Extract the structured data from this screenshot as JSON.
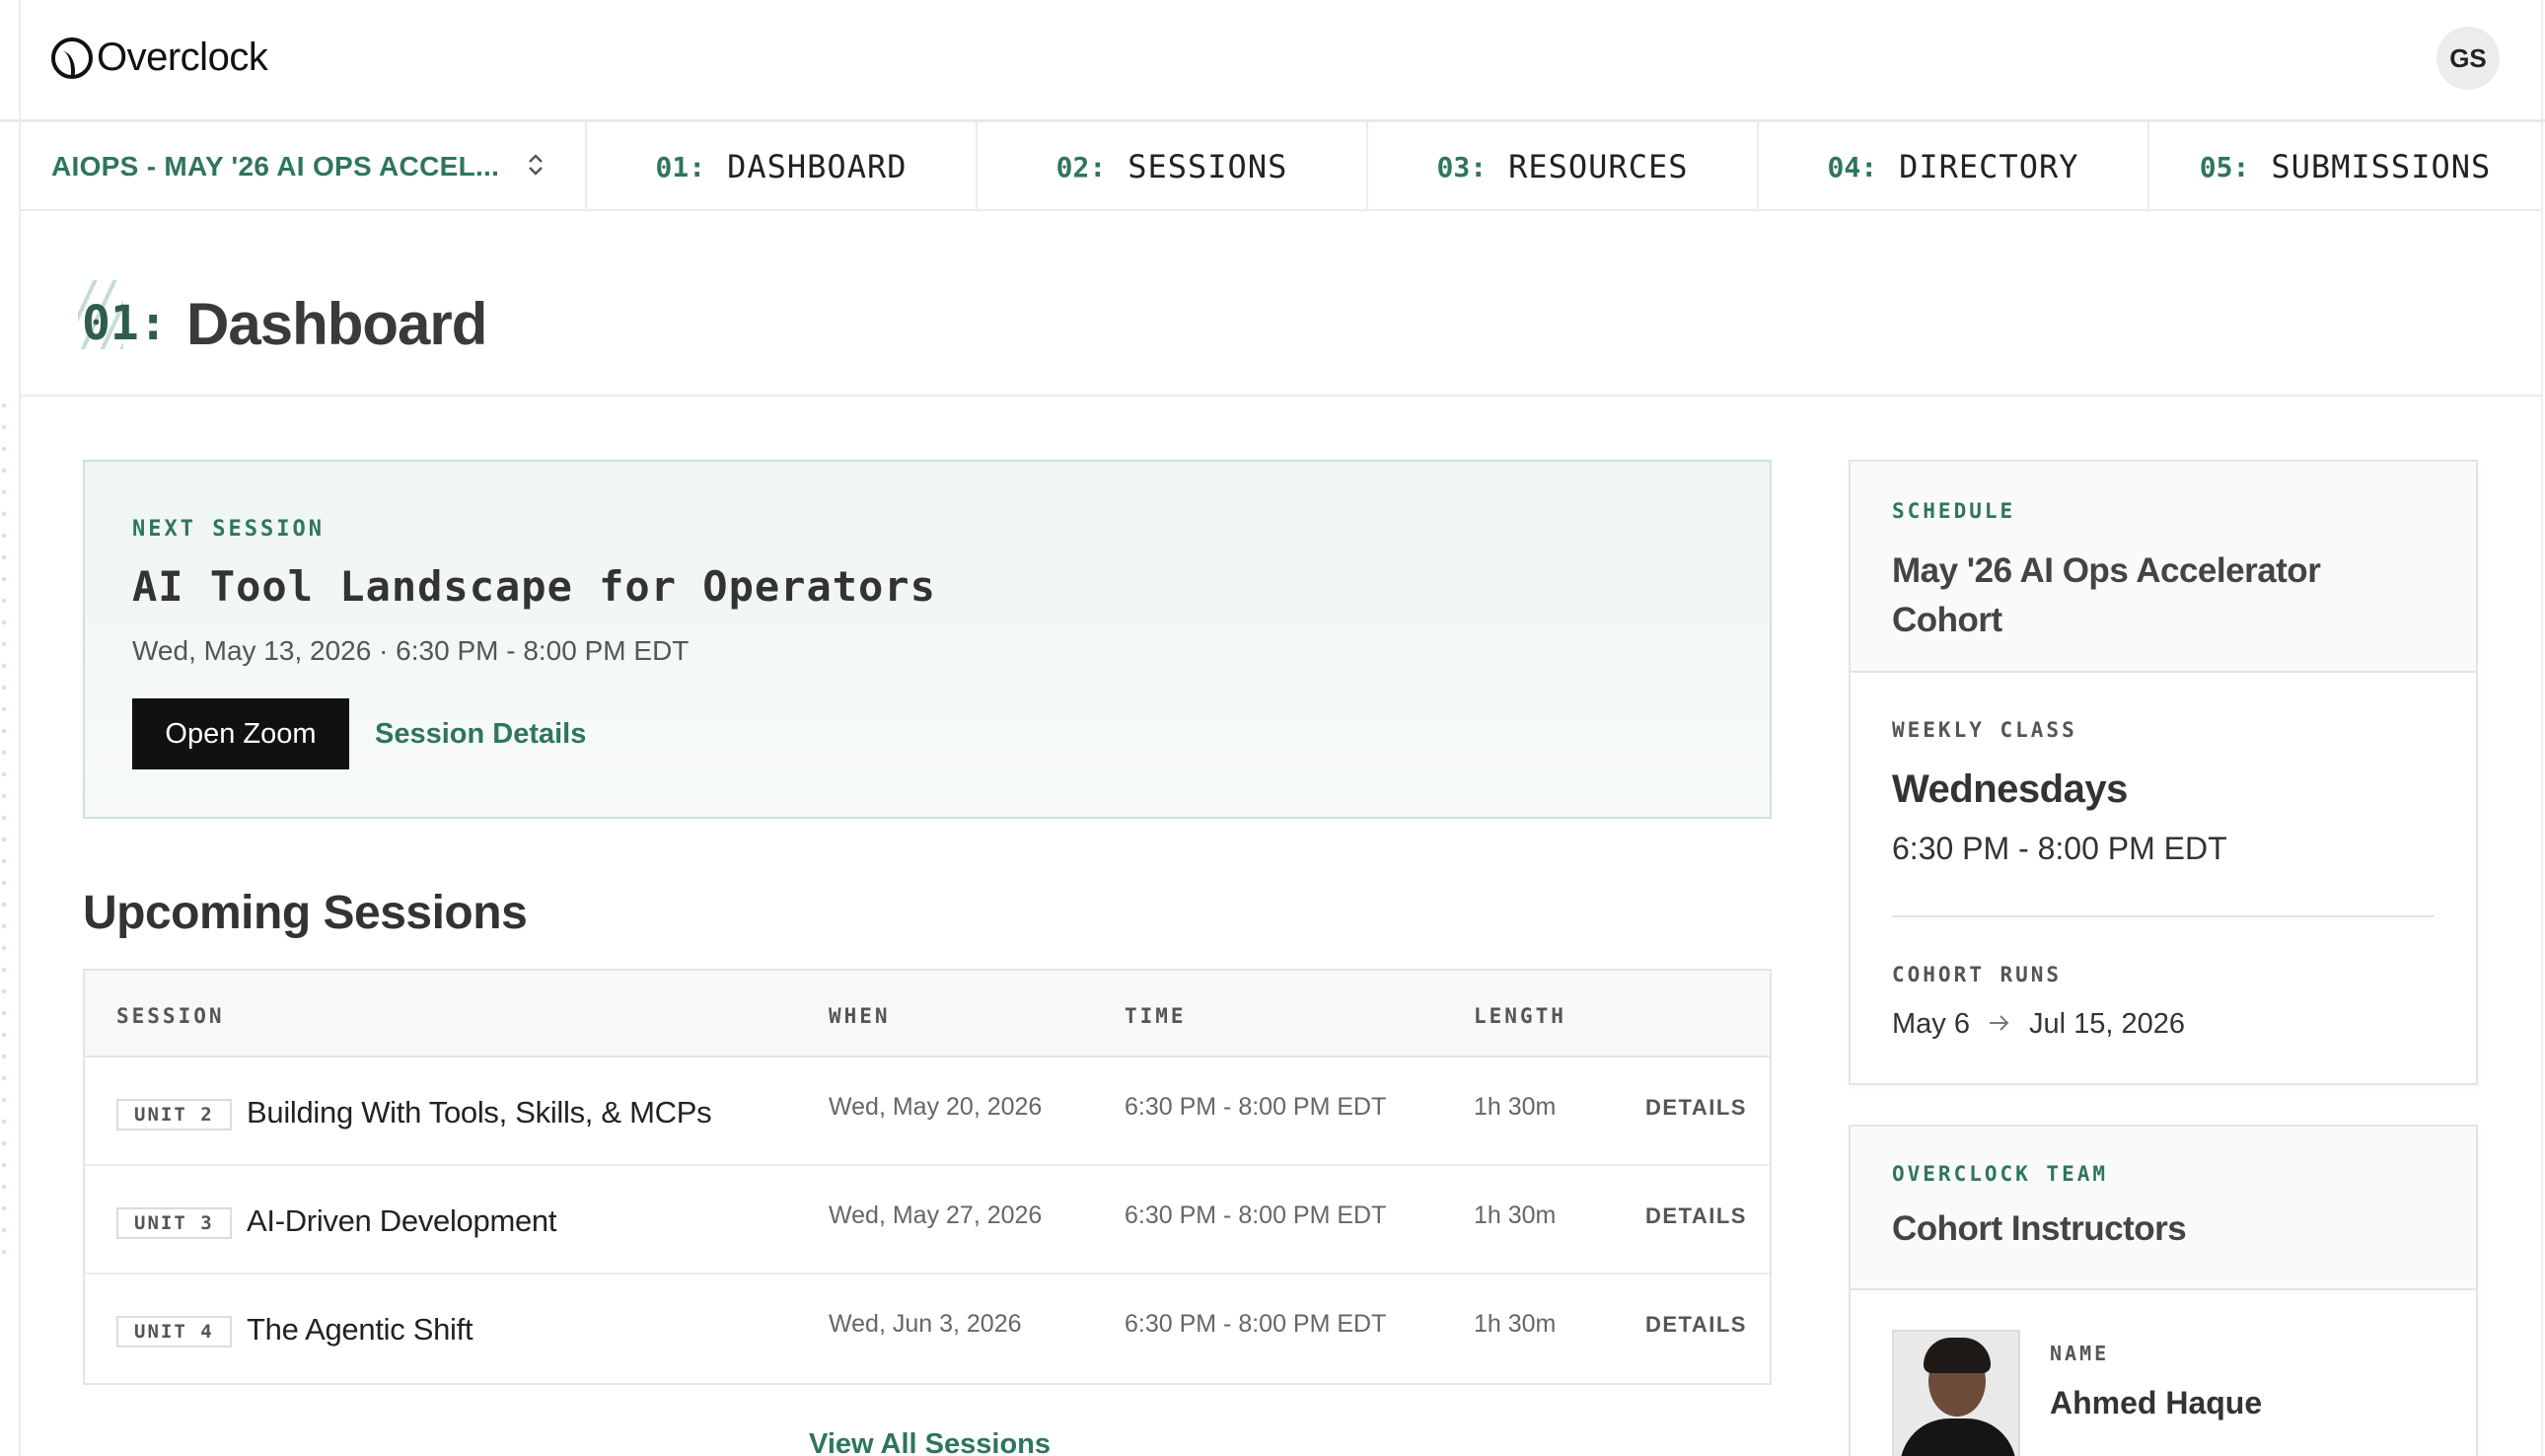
{
  "brand": {
    "name": "Overclock",
    "user_initials": "GS"
  },
  "nav": {
    "program": "AIOPS - MAY '26 AI OPS ACCEL...",
    "tabs": [
      {
        "num": "01:",
        "label": "DASHBOARD"
      },
      {
        "num": "02:",
        "label": "SESSIONS"
      },
      {
        "num": "03:",
        "label": "RESOURCES"
      },
      {
        "num": "04:",
        "label": "DIRECTORY"
      },
      {
        "num": "05:",
        "label": "SUBMISSIONS"
      }
    ]
  },
  "page": {
    "num": "01:",
    "title": "Dashboard"
  },
  "next_session": {
    "eyebrow": "NEXT SESSION",
    "title": "AI Tool Landscape for Operators",
    "when": "Wed, May 13, 2026 · 6:30 PM - 8:00 PM EDT",
    "zoom_label": "Open Zoom",
    "details_label": "Session Details"
  },
  "upcoming": {
    "heading": "Upcoming Sessions",
    "columns": {
      "session": "SESSION",
      "when": "WHEN",
      "time": "TIME",
      "length": "LENGTH"
    },
    "rows": [
      {
        "unit": "UNIT 2",
        "title": "Building With Tools, Skills, & MCPs",
        "when": "Wed, May 20, 2026",
        "time": "6:30 PM - 8:00 PM EDT",
        "length": "1h 30m",
        "details": "DETAILS"
      },
      {
        "unit": "UNIT 3",
        "title": "AI-Driven Development",
        "when": "Wed, May 27, 2026",
        "time": "6:30 PM - 8:00 PM EDT",
        "length": "1h 30m",
        "details": "DETAILS"
      },
      {
        "unit": "UNIT 4",
        "title": "The Agentic Shift",
        "when": "Wed, Jun 3, 2026",
        "time": "6:30 PM - 8:00 PM EDT",
        "length": "1h 30m",
        "details": "DETAILS"
      }
    ],
    "view_all": "View All Sessions"
  },
  "schedule": {
    "eyebrow": "SCHEDULE",
    "title": "May '26 AI Ops Accelerator Cohort",
    "weekly_label": "WEEKLY CLASS",
    "weekly_day": "Wednesdays",
    "weekly_time": "6:30 PM - 8:00 PM EDT",
    "runs_label": "COHORT RUNS",
    "runs_start": "May 6",
    "runs_end": "Jul 15, 2026"
  },
  "team": {
    "eyebrow": "OVERCLOCK TEAM",
    "title": "Cohort Instructors",
    "name_label": "NAME",
    "name": "Ahmed Haque"
  },
  "colors": {
    "accent": "#2e7560",
    "dark": "#111111",
    "border": "#e4e4e4"
  },
  "icons": {
    "selector": "chevron-up-down-icon",
    "range": "arrow-right-icon"
  }
}
